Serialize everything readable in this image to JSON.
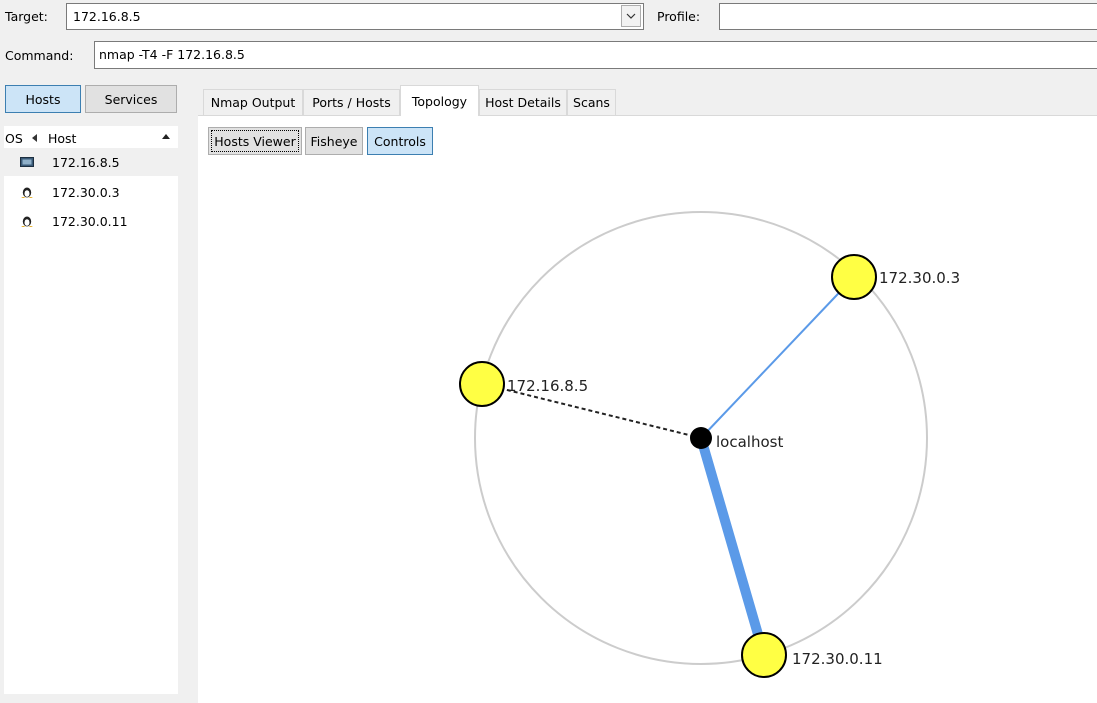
{
  "target": {
    "label": "Target:",
    "value": "172.16.8.5"
  },
  "profile": {
    "label": "Profile:",
    "value": ""
  },
  "command": {
    "label": "Command:",
    "value": "nmap -T4 -F 172.16.8.5"
  },
  "view_toggle": {
    "hosts": "Hosts",
    "services": "Services",
    "active": "hosts"
  },
  "host_list": {
    "col_os": "OS",
    "col_host": "Host",
    "hosts": [
      {
        "name": "172.16.8.5",
        "icon": "unknown-os-icon",
        "selected": true
      },
      {
        "name": "172.30.0.3",
        "icon": "linux-penguin-icon",
        "selected": false
      },
      {
        "name": "172.30.0.11",
        "icon": "linux-penguin-icon",
        "selected": false
      }
    ]
  },
  "tabs": [
    {
      "label": "Nmap Output",
      "active": false
    },
    {
      "label": "Ports / Hosts",
      "active": false
    },
    {
      "label": "Topology",
      "active": true
    },
    {
      "label": "Host Details",
      "active": false
    },
    {
      "label": "Scans",
      "active": false
    }
  ],
  "topology": {
    "buttons": {
      "hosts_viewer": "Hosts Viewer",
      "fisheye": "Fisheye",
      "controls": "Controls"
    },
    "center": {
      "label": "localhost"
    },
    "nodes": [
      {
        "label": "172.30.0.3",
        "edge": "thin-solid"
      },
      {
        "label": "172.16.8.5",
        "edge": "dashed"
      },
      {
        "label": "172.30.0.11",
        "edge": "thick-solid"
      }
    ],
    "colors": {
      "node_fill": "#ffff44",
      "edge_blue": "#5b9ae8",
      "ring": "#cccccc"
    }
  }
}
